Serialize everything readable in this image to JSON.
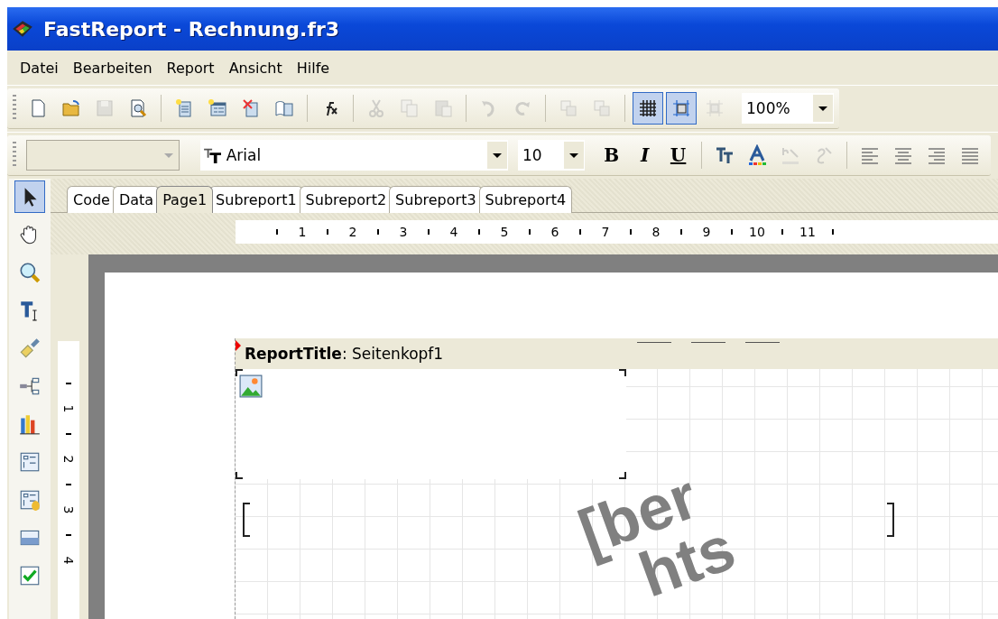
{
  "window": {
    "title": "FastReport - Rechnung.fr3"
  },
  "menu": [
    "Datei",
    "Bearbeiten",
    "Report",
    "Ansicht",
    "Hilfe"
  ],
  "toolbar_standard": [
    {
      "kind": "new",
      "disabled": false,
      "on": false
    },
    {
      "kind": "open",
      "disabled": false,
      "on": false
    },
    {
      "kind": "save",
      "disabled": true,
      "on": false
    },
    {
      "kind": "preview",
      "disabled": false,
      "on": false
    },
    {
      "kind": "sep"
    },
    {
      "kind": "newpage",
      "disabled": false,
      "on": false
    },
    {
      "kind": "newdialog",
      "disabled": false,
      "on": false
    },
    {
      "kind": "deletepage",
      "disabled": false,
      "on": false
    },
    {
      "kind": "pagesetup",
      "disabled": false,
      "on": false
    },
    {
      "kind": "sep"
    },
    {
      "kind": "fx",
      "disabled": false,
      "on": false
    },
    {
      "kind": "sep"
    },
    {
      "kind": "cut",
      "disabled": true,
      "on": false
    },
    {
      "kind": "copy",
      "disabled": true,
      "on": false
    },
    {
      "kind": "paste",
      "disabled": true,
      "on": false
    },
    {
      "kind": "sep"
    },
    {
      "kind": "undo",
      "disabled": true,
      "on": false
    },
    {
      "kind": "redo",
      "disabled": true,
      "on": false
    },
    {
      "kind": "sep"
    },
    {
      "kind": "group",
      "disabled": true,
      "on": false
    },
    {
      "kind": "ungroup",
      "disabled": true,
      "on": false
    },
    {
      "kind": "sep"
    },
    {
      "kind": "grid",
      "disabled": false,
      "on": true
    },
    {
      "kind": "snap",
      "disabled": false,
      "on": true
    },
    {
      "kind": "fitgrid",
      "disabled": true,
      "on": false
    }
  ],
  "zoom": {
    "value": "100%"
  },
  "toolbar_text": {
    "font": "Arial",
    "size": "10",
    "buttons": [
      {
        "kind": "bold",
        "label": "B",
        "disabled": false,
        "on": false
      },
      {
        "kind": "italic",
        "label": "I",
        "disabled": false,
        "on": false
      },
      {
        "kind": "underline",
        "label": "U",
        "disabled": false,
        "on": false
      },
      {
        "kind": "sep"
      },
      {
        "kind": "highlight",
        "disabled": false,
        "on": false
      },
      {
        "kind": "fontcolor",
        "disabled": false,
        "on": false
      },
      {
        "kind": "rotate",
        "disabled": true,
        "on": false
      },
      {
        "kind": "wrap",
        "disabled": true,
        "on": false
      },
      {
        "kind": "sep"
      },
      {
        "kind": "alignleft",
        "disabled": false,
        "on": false
      },
      {
        "kind": "aligncenter",
        "disabled": false,
        "on": false
      },
      {
        "kind": "alignright",
        "disabled": false,
        "on": false
      },
      {
        "kind": "justify",
        "disabled": false,
        "on": false
      }
    ]
  },
  "toolbox": [
    {
      "kind": "select",
      "selected": true
    },
    {
      "kind": "hand",
      "selected": false
    },
    {
      "kind": "zoom",
      "selected": false
    },
    {
      "kind": "text",
      "selected": false
    },
    {
      "kind": "brush",
      "selected": false
    },
    {
      "kind": "tree",
      "selected": false
    },
    {
      "kind": "chart",
      "selected": false
    },
    {
      "kind": "dialog",
      "selected": false
    },
    {
      "kind": "dbdialog",
      "selected": false
    },
    {
      "kind": "band",
      "selected": false
    },
    {
      "kind": "checkbox",
      "selected": false
    }
  ],
  "tabs": [
    {
      "label": "Code",
      "selected": false
    },
    {
      "label": "Data",
      "selected": false
    },
    {
      "label": "Page1",
      "selected": true
    },
    {
      "label": "Subreport1",
      "selected": false
    },
    {
      "label": "Subreport2",
      "selected": false
    },
    {
      "label": "Subreport3",
      "selected": false
    },
    {
      "label": "Subreport4",
      "selected": false
    }
  ],
  "ruler_h": [
    "1",
    "2",
    "3",
    "4",
    "5",
    "6",
    "7",
    "8",
    "9",
    "10",
    "11"
  ],
  "ruler_v": [
    "1",
    "2",
    "3",
    "4"
  ],
  "band": {
    "header": "**ReportTitle**: Seitenkopf1"
  },
  "rotated_text": [
    "[ber",
    "hts"
  ]
}
